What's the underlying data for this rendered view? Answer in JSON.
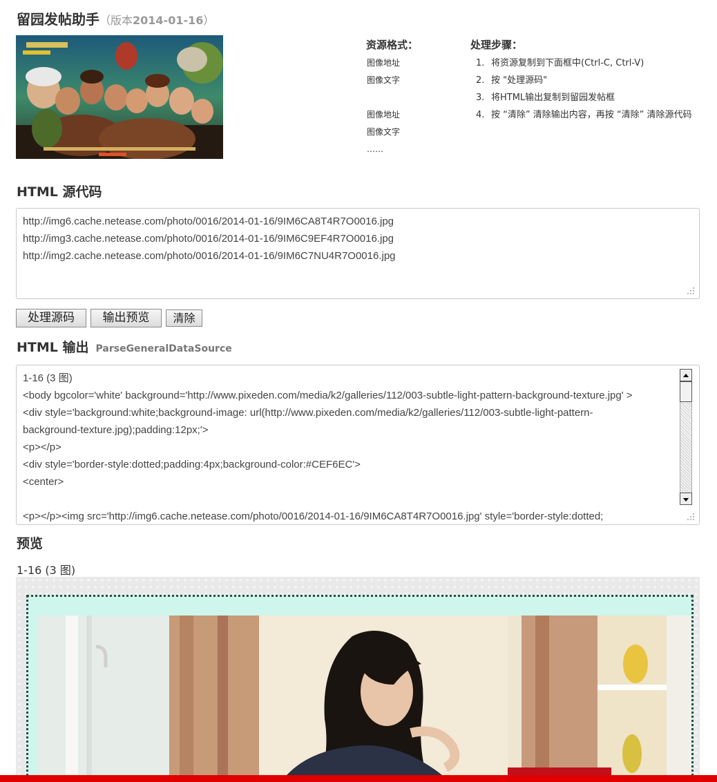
{
  "header": {
    "title": "留园发帖助手",
    "version_prefix": "（版本",
    "version_date": "2014-01-16",
    "version_suffix": "）"
  },
  "format": {
    "heading": "资源格式：",
    "items": [
      "图像地址",
      "图像文字",
      "",
      "图像地址",
      "图像文字",
      "……"
    ]
  },
  "steps": {
    "heading": "处理步骤：",
    "items": [
      {
        "num": "1.",
        "text": "将资源复制到下面框中(Ctrl-C, Ctrl-V)"
      },
      {
        "num": "2.",
        "text": "按 \"处理源码\""
      },
      {
        "num": "3.",
        "text": "将HTML输出复制到留园发帖框"
      },
      {
        "num": "4.",
        "text": "按 “清除” 清除输出内容，再按 “清除” 清除源代码"
      }
    ]
  },
  "source": {
    "heading": "HTML 源代码",
    "lines": [
      "http://img6.cache.netease.com/photo/0016/2014-01-16/9IM6CA8T4R7O0016.jpg",
      "http://img3.cache.netease.com/photo/0016/2014-01-16/9IM6C9EF4R7O0016.jpg",
      "http://img2.cache.netease.com/photo/0016/2014-01-16/9IM6C7NU4R7O0016.jpg"
    ]
  },
  "buttons": {
    "process": "处理源码",
    "preview": "输出预览",
    "clear": "清除"
  },
  "output": {
    "heading": "HTML 输出",
    "subheading": "ParseGeneralDataSource",
    "lines": [
      "1-16 (3 图)",
      "<body bgcolor='white' background='http://www.pixeden.com/media/k2/galleries/112/003-subtle-light-pattern-background-texture.jpg' >",
      "<div style='background:white;background-image: url(http://www.pixeden.com/media/k2/galleries/112/003-subtle-light-pattern-",
      "background-texture.jpg);padding:12px;'>",
      "<p></p>",
      "<div style='border-style:dotted;padding:4px;background-color:#CEF6EC'>",
      "<center>",
      "",
      "<p></p><img src='http://img6.cache.netease.com/photo/0016/2014-01-16/9IM6CA8T4R7O0016.jpg' style='border-style:dotted;"
    ]
  },
  "preview": {
    "heading": "预览",
    "caption": "1-16 (3 图)"
  },
  "colors": {
    "preview_inner_bg": "#CEF6EC",
    "bottom_bar": "#e00000"
  }
}
